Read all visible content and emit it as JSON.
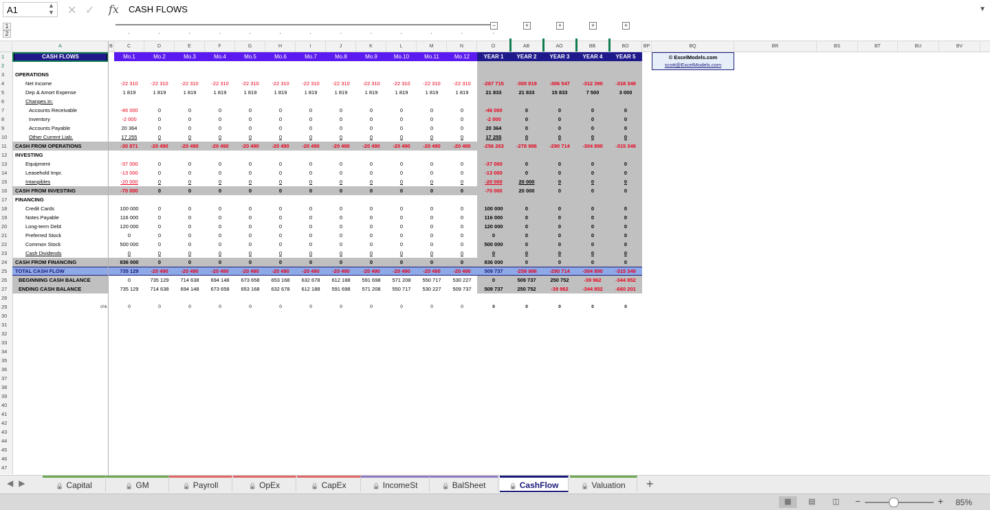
{
  "formula_bar": {
    "cell_ref": "A1",
    "content": "CASH FLOWS"
  },
  "outline_levels": [
    "1",
    "2"
  ],
  "col_headers": [
    "A",
    "B",
    "C",
    "D",
    "E",
    "F",
    "G",
    "H",
    "I",
    "J",
    "K",
    "L",
    "M",
    "N",
    "O",
    "AB",
    "AO",
    "BB",
    "BO",
    "BP",
    "BQ",
    "BR",
    "BS",
    "BT",
    "BU",
    "BV"
  ],
  "title_cell": "CASH FLOWS",
  "period_headers": [
    "Mo.1",
    "Mo.2",
    "Mo.3",
    "Mo.4",
    "Mo.5",
    "Mo.6",
    "Mo.7",
    "Mo.8",
    "Mo.9",
    "Mo.10",
    "Mo.11",
    "Mo.12",
    "YEAR 1",
    "YEAR 2",
    "YEAR 3",
    "YEAR 4",
    "YEAR 5"
  ],
  "credit": {
    "line1": "© ExcelModels.com",
    "line2": "scott@ExcelModels.com"
  },
  "rows": [
    {
      "n": "3",
      "label": "OPERATIONS",
      "style": "section",
      "vals": null
    },
    {
      "n": "4",
      "label": "Net Income",
      "style": "item",
      "vals": [
        "-22 310",
        "-22 310",
        "-22 310",
        "-22 310",
        "-22 310",
        "-22 310",
        "-22 310",
        "-22 310",
        "-22 310",
        "-22 310",
        "-22 310",
        "-22 310",
        "-267 715",
        "-300 819",
        "-306 547",
        "-312 390",
        "-318 349"
      ]
    },
    {
      "n": "5",
      "label": "Dep & Amort Expense",
      "style": "item",
      "vals": [
        "1 819",
        "1 819",
        "1 819",
        "1 819",
        "1 819",
        "1 819",
        "1 819",
        "1 819",
        "1 819",
        "1 819",
        "1 819",
        "1 819",
        "21 833",
        "21 833",
        "15 833",
        "7 500",
        "3 000"
      ]
    },
    {
      "n": "6",
      "label": "Changes in:",
      "style": "sub",
      "vals": null
    },
    {
      "n": "7",
      "label": "Accounts Receivable",
      "style": "item2",
      "vals": [
        "-46 000",
        "0",
        "0",
        "0",
        "0",
        "0",
        "0",
        "0",
        "0",
        "0",
        "0",
        "0",
        "-46 000",
        "0",
        "0",
        "0",
        "0"
      ]
    },
    {
      "n": "8",
      "label": "Inventory",
      "style": "item2",
      "vals": [
        "-2 000",
        "0",
        "0",
        "0",
        "0",
        "0",
        "0",
        "0",
        "0",
        "0",
        "0",
        "0",
        "-2 000",
        "0",
        "0",
        "0",
        "0"
      ]
    },
    {
      "n": "9",
      "label": "Accounts Payable",
      "style": "item2",
      "vals": [
        "20 364",
        "0",
        "0",
        "0",
        "0",
        "0",
        "0",
        "0",
        "0",
        "0",
        "0",
        "0",
        "20 364",
        "0",
        "0",
        "0",
        "0"
      ]
    },
    {
      "n": "10",
      "label": "Other Current Liab.",
      "style": "item2u",
      "vals": [
        "17 255",
        "0",
        "0",
        "0",
        "0",
        "0",
        "0",
        "0",
        "0",
        "0",
        "0",
        "0",
        "17 255",
        "0",
        "0",
        "0",
        "0"
      ]
    },
    {
      "n": "11",
      "label": "CASH FROM OPERATIONS",
      "style": "total",
      "vals": [
        "-30 871",
        "-20 490",
        "-20 490",
        "-20 490",
        "-20 490",
        "-20 490",
        "-20 490",
        "-20 490",
        "-20 490",
        "-20 490",
        "-20 490",
        "-20 490",
        "-256 263",
        "-278 986",
        "-290 714",
        "-304 890",
        "-315 349"
      ]
    },
    {
      "n": "12",
      "label": "INVESTING",
      "style": "section",
      "vals": null
    },
    {
      "n": "13",
      "label": "Equipment",
      "style": "item",
      "vals": [
        "-37 000",
        "0",
        "0",
        "0",
        "0",
        "0",
        "0",
        "0",
        "0",
        "0",
        "0",
        "0",
        "-37 000",
        "0",
        "0",
        "0",
        "0"
      ]
    },
    {
      "n": "14",
      "label": "Leasehold Impr.",
      "style": "item",
      "vals": [
        "-13 000",
        "0",
        "0",
        "0",
        "0",
        "0",
        "0",
        "0",
        "0",
        "0",
        "0",
        "0",
        "-13 000",
        "0",
        "0",
        "0",
        "0"
      ]
    },
    {
      "n": "15",
      "label": "Intangibles",
      "style": "itemu",
      "vals": [
        "-20 000",
        "0",
        "0",
        "0",
        "0",
        "0",
        "0",
        "0",
        "0",
        "0",
        "0",
        "0",
        "-20 000",
        "20 000",
        "0",
        "0",
        "0"
      ]
    },
    {
      "n": "16",
      "label": "CASH FROM INVESTING",
      "style": "total",
      "vals": [
        "-70 000",
        "0",
        "0",
        "0",
        "0",
        "0",
        "0",
        "0",
        "0",
        "0",
        "0",
        "0",
        "-70 000",
        "20 000",
        "0",
        "0",
        "0"
      ]
    },
    {
      "n": "17",
      "label": "FINANCING",
      "style": "section",
      "vals": null
    },
    {
      "n": "18",
      "label": "Credit Cards",
      "style": "item",
      "vals": [
        "100 000",
        "0",
        "0",
        "0",
        "0",
        "0",
        "0",
        "0",
        "0",
        "0",
        "0",
        "0",
        "100 000",
        "0",
        "0",
        "0",
        "0"
      ]
    },
    {
      "n": "19",
      "label": "Notes Payable",
      "style": "item",
      "vals": [
        "116 000",
        "0",
        "0",
        "0",
        "0",
        "0",
        "0",
        "0",
        "0",
        "0",
        "0",
        "0",
        "116 000",
        "0",
        "0",
        "0",
        "0"
      ]
    },
    {
      "n": "20",
      "label": "Long-term Debt",
      "style": "item",
      "vals": [
        "120 000",
        "0",
        "0",
        "0",
        "0",
        "0",
        "0",
        "0",
        "0",
        "0",
        "0",
        "0",
        "120 000",
        "0",
        "0",
        "0",
        "0"
      ]
    },
    {
      "n": "21",
      "label": "Preferred Stock",
      "style": "item",
      "vals": [
        "0",
        "0",
        "0",
        "0",
        "0",
        "0",
        "0",
        "0",
        "0",
        "0",
        "0",
        "0",
        "0",
        "0",
        "0",
        "0",
        "0"
      ]
    },
    {
      "n": "22",
      "label": "Common Stock",
      "style": "item",
      "vals": [
        "500 000",
        "0",
        "0",
        "0",
        "0",
        "0",
        "0",
        "0",
        "0",
        "0",
        "0",
        "0",
        "500 000",
        "0",
        "0",
        "0",
        "0"
      ]
    },
    {
      "n": "23",
      "label": "Cash Dividends",
      "style": "itemu",
      "vals": [
        "0",
        "0",
        "0",
        "0",
        "0",
        "0",
        "0",
        "0",
        "0",
        "0",
        "0",
        "0",
        "0",
        "0",
        "0",
        "0",
        "0"
      ]
    },
    {
      "n": "24",
      "label": "CASH FROM FINANCING",
      "style": "total",
      "vals": [
        "836 000",
        "0",
        "0",
        "0",
        "0",
        "0",
        "0",
        "0",
        "0",
        "0",
        "0",
        "0",
        "836 000",
        "0",
        "0",
        "0",
        "0"
      ]
    },
    {
      "n": "25",
      "label": "TOTAL CASH FLOW",
      "style": "grand",
      "vals": [
        "735 129",
        "-20 490",
        "-20 490",
        "-20 490",
        "-20 490",
        "-20 490",
        "-20 490",
        "-20 490",
        "-20 490",
        "-20 490",
        "-20 490",
        "-20 490",
        "509 737",
        "-258 986",
        "-290 714",
        "-304 890",
        "-315 349"
      ]
    },
    {
      "n": "26",
      "label": "BEGINNING CASH BALANCE",
      "style": "bal",
      "vals": [
        "0",
        "735 129",
        "714 638",
        "694 148",
        "673 658",
        "653 168",
        "632 678",
        "612 188",
        "591 698",
        "571 208",
        "550 717",
        "530 227",
        "0",
        "509 737",
        "250 752",
        "-39 962",
        "-344 852"
      ]
    },
    {
      "n": "27",
      "label": "ENDING CASH BALANCE",
      "style": "bal",
      "vals": [
        "735 129",
        "714 638",
        "694 148",
        "673 658",
        "653 168",
        "632 678",
        "612 188",
        "591 698",
        "571 208",
        "550 717",
        "530 227",
        "509 737",
        "509 737",
        "250 752",
        "-39 962",
        "-344 852",
        "-660 201"
      ]
    },
    {
      "n": "28",
      "label": "",
      "style": "blank",
      "vals": null
    },
    {
      "n": "29",
      "label": "chk",
      "style": "chk",
      "vals": [
        "0",
        "0",
        "0",
        "0",
        "0",
        "0",
        "0",
        "0",
        "0",
        "0",
        "0",
        "0",
        "0",
        "0",
        "0",
        "0",
        "0"
      ]
    }
  ],
  "empty_rows": [
    "30",
    "31",
    "32",
    "33",
    "34",
    "35",
    "36",
    "37",
    "38",
    "39",
    "40",
    "41",
    "42",
    "43",
    "44",
    "45",
    "46",
    "47"
  ],
  "sheet_tabs": [
    {
      "label": "Capital",
      "color": "#6aa84f"
    },
    {
      "label": "GM",
      "color": "#6aa84f"
    },
    {
      "label": "Payroll",
      "color": "#e06666"
    },
    {
      "label": "OpEx",
      "color": "#e06666"
    },
    {
      "label": "CapEx",
      "color": "#e06666"
    },
    {
      "label": "IncomeSt",
      "color": "#8e7cc3"
    },
    {
      "label": "BalSheet",
      "color": "#8e7cc3"
    },
    {
      "label": "CashFlow",
      "color": "#1b1b7a"
    },
    {
      "label": "Valuation",
      "color": "#6aa84f"
    }
  ],
  "active_tab": "CashFlow",
  "zoom": "85%",
  "colors": {
    "header_fill": "#5b1bf0",
    "title_fill": "#1f1a8c",
    "negative": "#e8001c",
    "total_fill": "#c0c0c0",
    "grand_fill": "#8ea9e8",
    "group_bar": "#0f7b4f"
  }
}
